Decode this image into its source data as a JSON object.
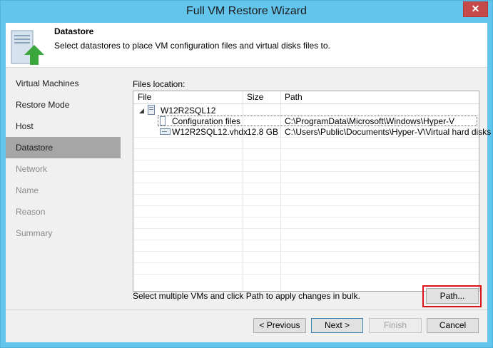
{
  "window": {
    "title": "Full VM Restore Wizard",
    "close_glyph": "✕"
  },
  "header": {
    "title": "Datastore",
    "description": "Select datastores to place VM configuration files and virtual disks files to."
  },
  "nav": {
    "items": [
      {
        "label": "Virtual Machines",
        "state": "normal"
      },
      {
        "label": "Restore Mode",
        "state": "normal"
      },
      {
        "label": "Host",
        "state": "normal"
      },
      {
        "label": "Datastore",
        "state": "active"
      },
      {
        "label": "Network",
        "state": "disabled"
      },
      {
        "label": "Name",
        "state": "disabled"
      },
      {
        "label": "Reason",
        "state": "disabled"
      },
      {
        "label": "Summary",
        "state": "disabled"
      }
    ]
  },
  "files": {
    "label": "Files location:",
    "columns": [
      "File",
      "Size",
      "Path"
    ],
    "vm": {
      "name": "W12R2SQL12",
      "expander": "◢"
    },
    "rows": [
      {
        "file": "Configuration files",
        "size": "",
        "path": "C:\\ProgramData\\Microsoft\\Windows\\Hyper-V"
      },
      {
        "file": "W12R2SQL12.vhdx",
        "size": "12.8 GB",
        "path": "C:\\Users\\Public\\Documents\\Hyper-V\\Virtual hard disks"
      }
    ]
  },
  "bulk_hint": "Select multiple VMs and click Path to apply changes in bulk.",
  "buttons": {
    "path": "Path...",
    "previous": "< Previous",
    "next": "Next >",
    "finish": "Finish",
    "cancel": "Cancel"
  },
  "colors": {
    "titlebar": "#63c4ec",
    "active_nav": "#a6a6a6",
    "highlight": "#d9141b",
    "close": "#c74a4a"
  }
}
